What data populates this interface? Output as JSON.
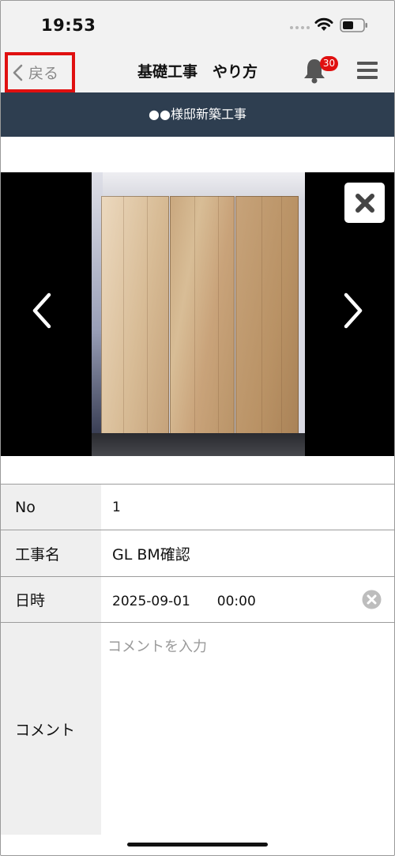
{
  "status_bar": {
    "time": "19:53",
    "icons": [
      "signal-icon",
      "wifi-icon",
      "battery-icon"
    ]
  },
  "navbar": {
    "back_label": "戻る",
    "title": "基礎工事　やり方",
    "notification_count": "30",
    "icons": [
      "chevron-left-icon",
      "bell-icon",
      "hamburger-menu-icon"
    ]
  },
  "banner": {
    "project": "●●様邸新築工事"
  },
  "viewer": {
    "icons": [
      "chevron-left-icon",
      "chevron-right-icon",
      "close-icon"
    ]
  },
  "form": {
    "rows": [
      {
        "label": "No",
        "value": "1"
      },
      {
        "label": "工事名",
        "value": "GL BM確認"
      },
      {
        "label": "日時",
        "value": "2025-09-01　　00:00"
      },
      {
        "label": "コメント",
        "value": "",
        "placeholder": "コメントを入力"
      }
    ]
  },
  "colors": {
    "accent_red": "#e01010",
    "banner_bg": "#2e3e50",
    "label_bg": "#efefef"
  }
}
